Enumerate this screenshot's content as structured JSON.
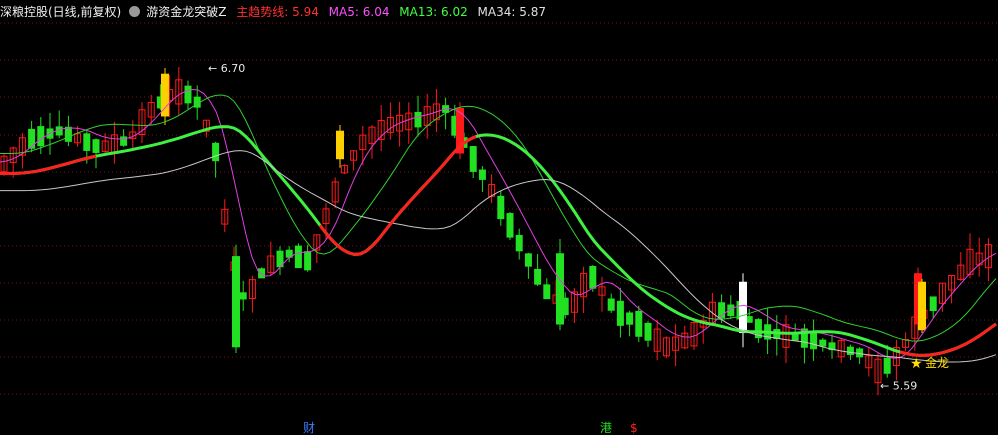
{
  "header": {
    "stock_title": "深粮控股(日线,前复权)",
    "indicator_name": "游资金龙突破Z",
    "trend_label": "主趋势线:",
    "trend_value": "5.94",
    "ma5_label": "MA5:",
    "ma5_value": "6.04",
    "ma13_label": "MA13:",
    "ma13_value": "6.02",
    "ma34_label": "MA34:",
    "ma34_value": "5.87",
    "settings_icon": "gear-icon"
  },
  "colors": {
    "background": "#000000",
    "grid": "#7a1010",
    "up": "#ff1a1a",
    "down": "#22e022",
    "white_candle": "#ffffff",
    "yellow_bar": "#ffd000",
    "trend": "#ff2020",
    "ma5": "#e040e0",
    "ma13": "#40f040",
    "ma34": "#c8c8c8",
    "ma_extra": "#30d030",
    "label_white": "#e8e8e8",
    "title_white": "#f0f0f0",
    "indicator_white": "#f0f0f0",
    "trend_color": "#ff3030",
    "ma5_color": "#ff50ff",
    "ma13_color": "#40ff40",
    "ma34_color": "#e0e0e0",
    "jinlong_text": "#ffe000",
    "cai": "#3a7cff",
    "gang": "#22e022",
    "dollar": "#ff2020"
  },
  "chart_data": {
    "type": "candlestick",
    "title": "游资金龙突破Z",
    "ylim": [
      5.5,
      6.8
    ],
    "max_label": "6.70",
    "min_label": "5.59",
    "max_value": 6.7,
    "min_value": 5.59,
    "marker_label": "金龙",
    "bottom_labels": [
      "财",
      "港",
      "$"
    ],
    "legend": [
      {
        "name": "主趋势线",
        "value": 5.94
      },
      {
        "name": "MA5",
        "value": 6.04
      },
      {
        "name": "MA13",
        "value": 6.02
      },
      {
        "name": "MA34",
        "value": 5.87
      }
    ]
  }
}
